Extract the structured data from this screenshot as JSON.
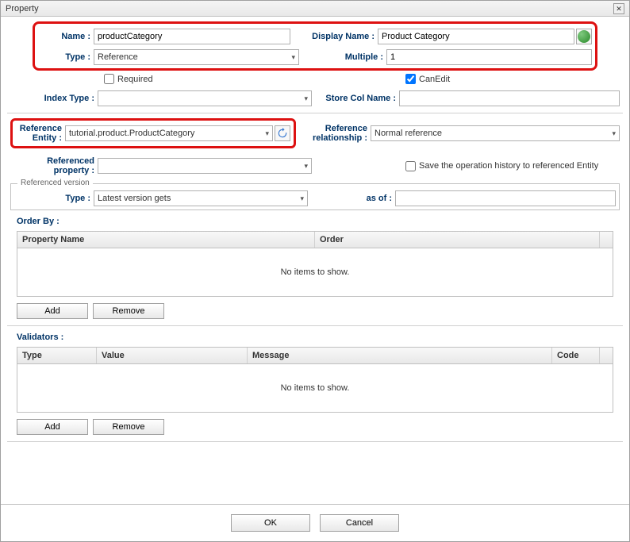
{
  "window": {
    "title": "Property"
  },
  "form": {
    "name": {
      "label": "Name :",
      "value": "productCategory"
    },
    "displayName": {
      "label": "Display Name :",
      "value": "Product Category"
    },
    "type": {
      "label": "Type :",
      "value": "Reference"
    },
    "multiple": {
      "label": "Multiple :",
      "value": "1"
    },
    "required": {
      "label": "Required",
      "checked": false
    },
    "canEdit": {
      "label": "CanEdit",
      "checked": true
    },
    "indexType": {
      "label": "Index Type :",
      "value": ""
    },
    "storeColName": {
      "label": "Store Col Name :",
      "value": ""
    },
    "refEntity": {
      "label": "Reference Entity :",
      "value": "tutorial.product.ProductCategory"
    },
    "refRelationship": {
      "label": "Reference relationship :",
      "value": "Normal reference"
    },
    "refProperty": {
      "label": "Referenced property :",
      "value": ""
    },
    "saveHistory": {
      "label": "Save the operation history to referenced Entity",
      "checked": false
    }
  },
  "referencedVersion": {
    "legend": "Referenced version",
    "type": {
      "label": "Type :",
      "value": "Latest version gets"
    },
    "asOf": {
      "label": "as of :",
      "value": ""
    }
  },
  "orderBy": {
    "label": "Order By :",
    "columns": {
      "propertyName": "Property Name",
      "order": "Order"
    },
    "empty": "No items to show."
  },
  "validators": {
    "label": "Validators :",
    "columns": {
      "type": "Type",
      "value": "Value",
      "message": "Message",
      "code": "Code"
    },
    "empty": "No items to show."
  },
  "buttons": {
    "add": "Add",
    "remove": "Remove",
    "ok": "OK",
    "cancel": "Cancel"
  }
}
